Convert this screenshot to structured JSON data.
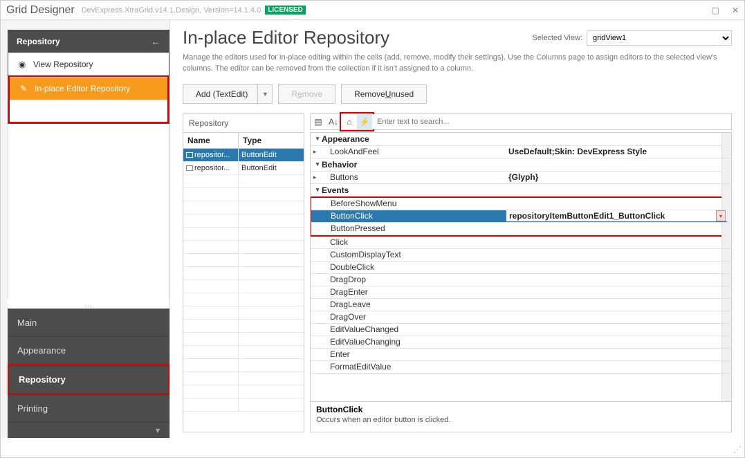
{
  "window": {
    "title": "Grid Designer",
    "meta": "DevExpress.XtraGrid.v14.1.Design, Version=14.1.4.0",
    "badge": "LICENSED"
  },
  "sidebar": {
    "header": "Repository",
    "items": [
      {
        "label": "View Repository"
      },
      {
        "label": "In-place Editor Repository"
      }
    ]
  },
  "nav": {
    "items": [
      "Main",
      "Appearance",
      "Repository",
      "Printing"
    ],
    "selected": "Repository"
  },
  "header": {
    "title": "In-place Editor Repository",
    "selected_view_label": "Selected View:",
    "selected_view": "gridView1",
    "description": "Manage the editors used for in-place editing within the cells (add, remove, modify their settings). Use the Columns page to assign editors to the selected view's columns. The editor can be removed from the collection if it isn't assigned to a column."
  },
  "toolbar": {
    "add": "Add (TextEdit)",
    "remove_pre": "R",
    "remove_u": "e",
    "remove_post": "move",
    "remove_unused_pre": "Remove ",
    "remove_unused_u": "U",
    "remove_unused_post": "nused"
  },
  "repo": {
    "title": "Repository",
    "cols": {
      "name": "Name",
      "type": "Type"
    },
    "rows": [
      {
        "name": "repositor...",
        "type": "ButtonEdit",
        "selected": true
      },
      {
        "name": "repositor...",
        "type": "ButtonEdit",
        "selected": false
      }
    ],
    "blank_rows": 18
  },
  "search": {
    "placeholder": "Enter text to search..."
  },
  "props": {
    "categories": [
      {
        "name": "Appearance",
        "expanded": true,
        "rows": [
          {
            "name": "LookAndFeel",
            "value": "UseDefault;Skin: DevExpress Style",
            "expandable": true
          }
        ]
      },
      {
        "name": "Behavior",
        "expanded": true,
        "rows": [
          {
            "name": "Buttons",
            "value": "{Glyph}",
            "expandable": true
          }
        ]
      },
      {
        "name": "Events",
        "expanded": true,
        "highlight": true,
        "rows": [
          {
            "name": "BeforeShowMenu",
            "value": ""
          },
          {
            "name": "ButtonClick",
            "value": "repositoryItemButtonEdit1_ButtonClick",
            "selected": true
          },
          {
            "name": "ButtonPressed",
            "value": ""
          },
          {
            "name": "Click",
            "value": "",
            "out": true
          },
          {
            "name": "CustomDisplayText",
            "value": "",
            "out": true
          },
          {
            "name": "DoubleClick",
            "value": "",
            "out": true
          },
          {
            "name": "DragDrop",
            "value": "",
            "out": true
          },
          {
            "name": "DragEnter",
            "value": "",
            "out": true
          },
          {
            "name": "DragLeave",
            "value": "",
            "out": true
          },
          {
            "name": "DragOver",
            "value": "",
            "out": true
          },
          {
            "name": "EditValueChanged",
            "value": "",
            "out": true
          },
          {
            "name": "EditValueChanging",
            "value": "",
            "out": true
          },
          {
            "name": "Enter",
            "value": "",
            "out": true
          },
          {
            "name": "FormatEditValue",
            "value": "",
            "out": true
          }
        ]
      }
    ],
    "desc_title": "ButtonClick",
    "desc_text": "Occurs when an editor button is clicked."
  }
}
